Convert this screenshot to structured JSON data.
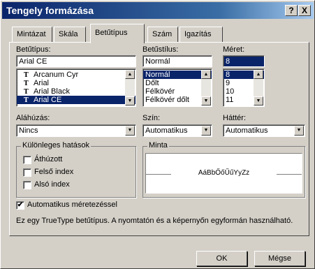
{
  "window": {
    "title": "Tengely formázása",
    "help_label": "?",
    "close_label": "X"
  },
  "tabs": [
    {
      "label": "Mintázat"
    },
    {
      "label": "Skála"
    },
    {
      "label": "Betűtípus"
    },
    {
      "label": "Szám"
    },
    {
      "label": "Igazítás"
    }
  ],
  "font": {
    "label": "Betűtípus:",
    "value": "Arial CE",
    "items": [
      {
        "label": "Arcanum Cyr",
        "icon": "T"
      },
      {
        "label": "Arial",
        "icon": "T"
      },
      {
        "label": "Arial Black",
        "icon": "T"
      },
      {
        "label": "Arial CE",
        "icon": "T"
      }
    ]
  },
  "style": {
    "label": "Betűstílus:",
    "value": "Normál",
    "items": [
      {
        "label": "Normál"
      },
      {
        "label": "Dőlt"
      },
      {
        "label": "Félkövér"
      },
      {
        "label": "Félkövér dőlt"
      }
    ]
  },
  "size": {
    "label": "Méret:",
    "value": "8",
    "items": [
      {
        "label": "8"
      },
      {
        "label": "9"
      },
      {
        "label": "10"
      },
      {
        "label": "11"
      }
    ]
  },
  "underline": {
    "label": "Aláhúzás:",
    "value": "Nincs"
  },
  "color": {
    "label": "Szín:",
    "value": "Automatikus"
  },
  "background": {
    "label": "Háttér:",
    "value": "Automatikus"
  },
  "effects": {
    "label": "Különleges hatások",
    "items": [
      {
        "label": "Áthúzott"
      },
      {
        "label": "Felső index"
      },
      {
        "label": "Alsó index"
      }
    ]
  },
  "preview": {
    "label": "Minta",
    "sample": "AáBbŐőŰűYyZz"
  },
  "autoscale": {
    "label": "Automatikus méretezéssel",
    "checked": true
  },
  "info": {
    "text": "Ez egy TrueType betűtípus.  A nyomtatón és a képernyőn egyformán használható."
  },
  "buttons": {
    "ok": "OK",
    "cancel": "Mégse"
  },
  "colors": {
    "title_start": "#0a246a",
    "title_end": "#a6caf0",
    "selection": "#0a246a",
    "face": "#d4d0c8"
  }
}
